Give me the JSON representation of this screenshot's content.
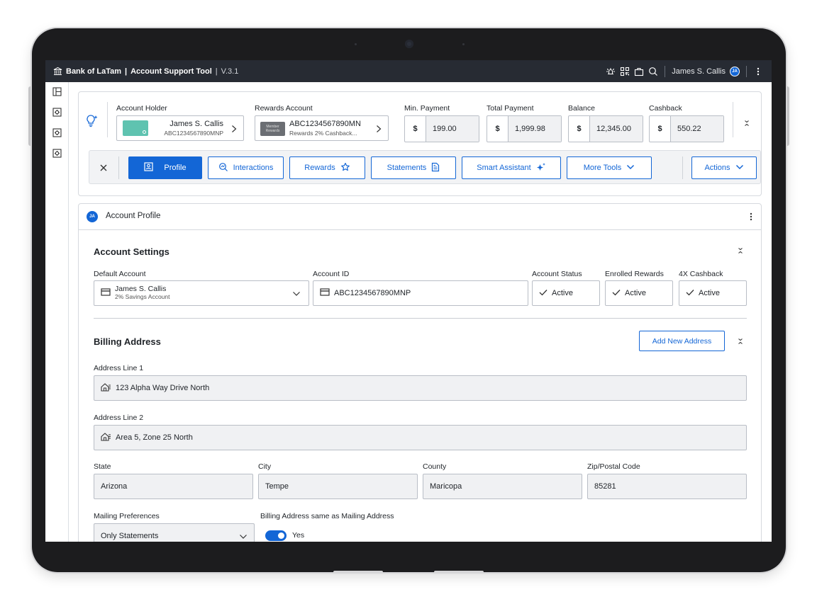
{
  "app": {
    "brand": "Bank of LaTam",
    "tool": "Account Support Tool",
    "version": "V.3.1",
    "user_name": "James S. Callis",
    "user_initials": "JA"
  },
  "summary": {
    "account_holder_label": "Account Holder",
    "account_holder_name": "James S. Callis",
    "account_holder_number": "ABC1234567890MNP",
    "rewards_account_label": "Rewards Account",
    "rewards_badge_line1": "Member",
    "rewards_badge_line2": "Rewards",
    "rewards_account_number": "ABC1234567890MN",
    "rewards_account_desc": "Rewards 2% Cashback...",
    "min_payment_label": "Min. Payment",
    "min_payment_currency": "$",
    "min_payment_value": "199.00",
    "total_payment_label": "Total Payment",
    "total_payment_currency": "$",
    "total_payment_value": "1,999.98",
    "balance_label": "Balance",
    "balance_currency": "$",
    "balance_value": "12,345.00",
    "cashback_label": "Cashback",
    "cashback_currency": "$",
    "cashback_value": "550.22"
  },
  "tabs": {
    "profile": "Profile",
    "interactions": "Interactions",
    "rewards": "Rewards",
    "statements": "Statements",
    "smart_assistant": "Smart Assistant",
    "more_tools": "More Tools",
    "actions": "Actions"
  },
  "profile_panel": {
    "avatar_initials": "JA",
    "title": "Account Profile"
  },
  "account_settings": {
    "title": "Account Settings",
    "default_account_label": "Default Account",
    "default_account_name": "James S. Callis",
    "default_account_sub": "2% Savings Account",
    "account_id_label": "Account ID",
    "account_id_value": "ABC1234567890MNP",
    "account_status_label": "Account Status",
    "account_status_value": "Active",
    "enrolled_rewards_label": "Enrolled Rewards",
    "enrolled_rewards_value": "Active",
    "cashback_4x_label": "4X Cashback",
    "cashback_4x_value": "Active"
  },
  "billing": {
    "title": "Billing Address",
    "add_button": "Add New Address",
    "line1_label": "Address Line 1",
    "line1_value": "123 Alpha Way Drive North",
    "line2_label": "Address Line 2",
    "line2_value": "Area 5, Zone 25 North",
    "state_label": "State",
    "state_value": "Arizona",
    "city_label": "City",
    "city_value": "Tempe",
    "county_label": "County",
    "county_value": "Maricopa",
    "zip_label": "Zip/Postal Code",
    "zip_value": "85281",
    "mailing_label": "Mailing Preferences",
    "mailing_value": "Only Statements",
    "same_as_label": "Billing Address same as Mailing Address",
    "same_as_value": "Yes",
    "same_as_on": true
  },
  "colors": {
    "accent": "#1366d6",
    "topbar": "#272b33",
    "card_teal": "#5fc3b0"
  }
}
